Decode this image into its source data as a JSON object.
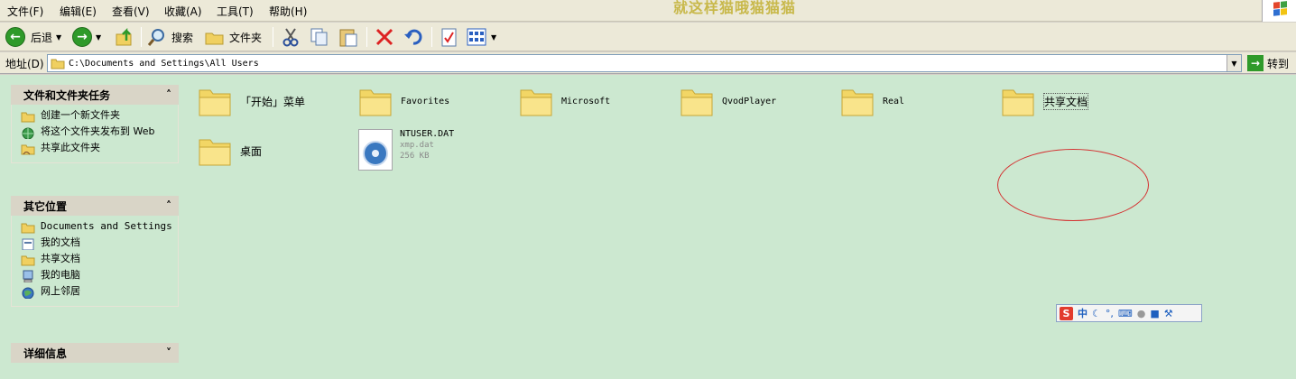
{
  "menu": {
    "items": [
      "文件(F)",
      "编辑(E)",
      "查看(V)",
      "收藏(A)",
      "工具(T)",
      "帮助(H)"
    ]
  },
  "overlay_text": "就这样猫哦猫猫猫",
  "toolbar": {
    "back_label": "后退",
    "search_label": "搜索",
    "folders_label": "文件夹"
  },
  "address": {
    "label": "地址(D)",
    "value": "C:\\Documents and Settings\\All Users",
    "go_label": "转到"
  },
  "left_pane": {
    "tasks": {
      "title": "文件和文件夹任务",
      "items": [
        "创建一个新文件夹",
        "将这个文件夹发布到 Web",
        "共享此文件夹"
      ]
    },
    "other_places": {
      "title": "其它位置",
      "items": [
        "Documents and Settings",
        "我的文档",
        "共享文档",
        "我的电脑",
        "网上邻居"
      ]
    },
    "details": {
      "title": "详细信息"
    }
  },
  "files": [
    {
      "name": "「开始」菜单",
      "type": "folder"
    },
    {
      "name": "Favorites",
      "type": "folder"
    },
    {
      "name": "Microsoft",
      "type": "folder"
    },
    {
      "name": "QvodPlayer",
      "type": "folder"
    },
    {
      "name": "Real",
      "type": "folder"
    },
    {
      "name": "共享文档",
      "type": "folder"
    },
    {
      "name": "桌面",
      "type": "folder"
    },
    {
      "name": "NTUSER.DAT",
      "type": "file",
      "kind": "xmp.dat",
      "size": "256 KB"
    }
  ],
  "ime": {
    "logo": "S",
    "mode": "中"
  },
  "colors": {
    "main_bg": "#cce8d0",
    "chrome_bg": "#ece9d8",
    "highlight": "#d43030"
  }
}
